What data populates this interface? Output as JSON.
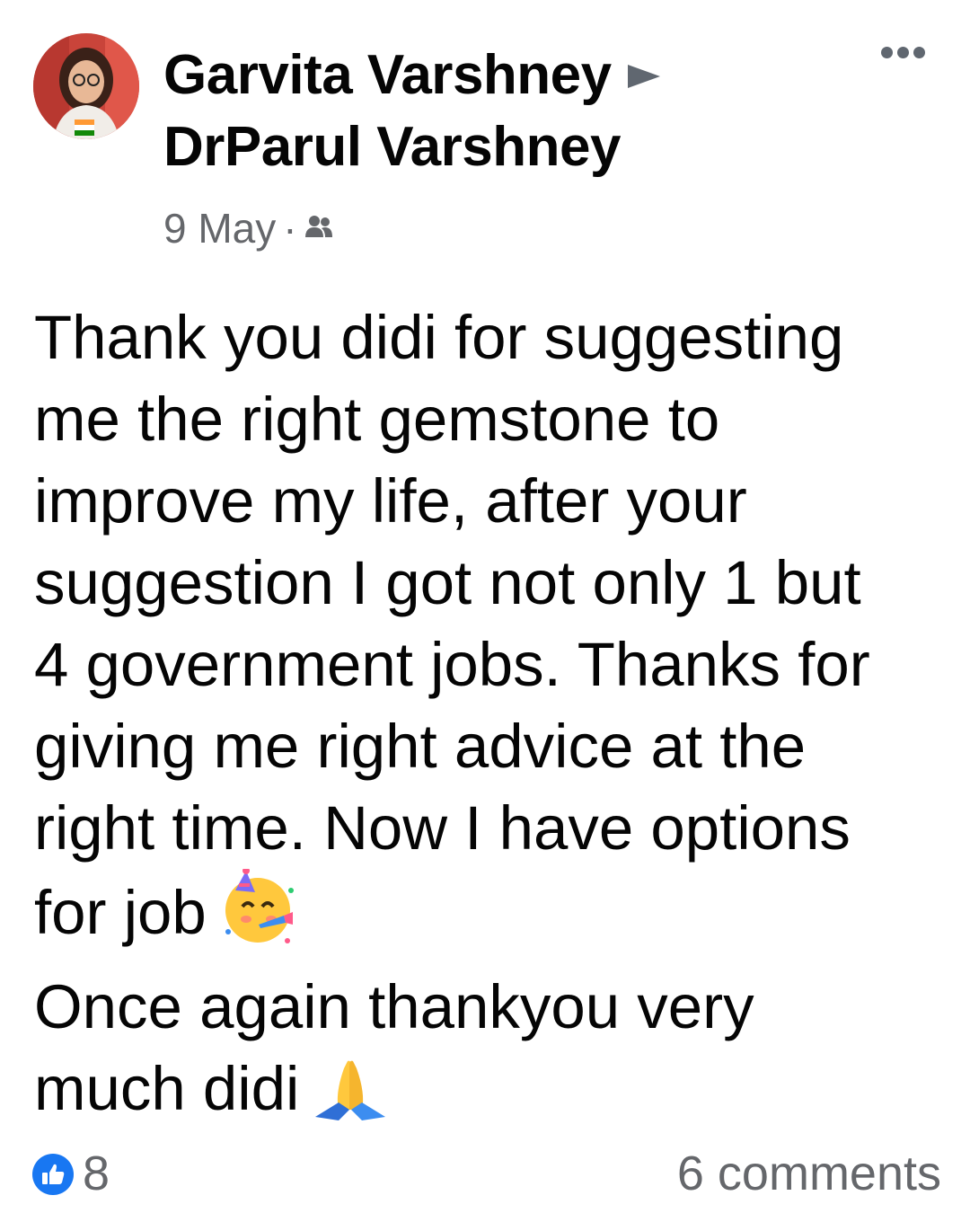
{
  "post": {
    "author_name": "Garvita Varshney",
    "target_name": "DrParul Varshney",
    "date": "9 May",
    "separator": "·",
    "audience_icon": "friends-icon",
    "menu_icon": "more-options-icon",
    "body_lines": [
      "Thank you didi for suggesting",
      "me the right gemstone to",
      "improve my life, after your",
      "suggestion I got not only 1 but",
      "4 government jobs. Thanks for",
      "giving me right advice at the",
      "right time. Now I have options",
      "for job",
      "Once again thankyou very",
      "much didi"
    ],
    "emojis": [
      "partying-face",
      "folded-hands"
    ]
  },
  "footer": {
    "reaction_icon": "like-icon",
    "reaction_count": "8",
    "comments_label": "6 comments"
  },
  "colors": {
    "text": "#050505",
    "secondary": "#65676b",
    "like_blue": "#1877f2"
  }
}
